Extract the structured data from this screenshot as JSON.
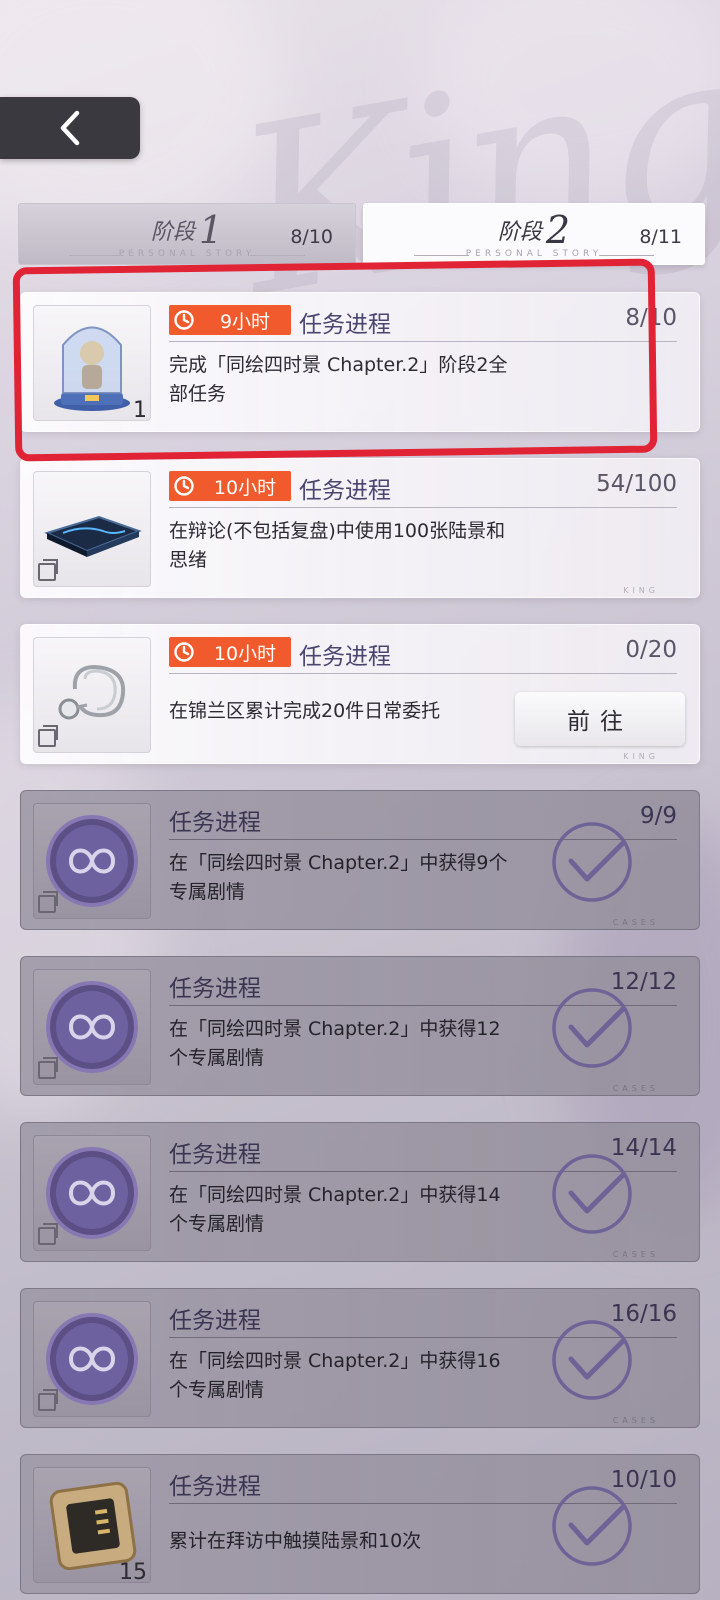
{
  "tabs": [
    {
      "stage_label": "阶段",
      "stage_number": "1",
      "subtitle": "PERSONAL STORY",
      "count": "8/10",
      "selected": false
    },
    {
      "stage_label": "阶段",
      "stage_number": "2",
      "subtitle": "PERSONAL STORY",
      "count": "8/11",
      "selected": true
    }
  ],
  "background_text": "King",
  "tasks": [
    {
      "timer": "9小时",
      "label": "任务进程",
      "progress": "8/10",
      "desc": "完成「同绘四时景 Chapter.2」阶段2全部任务",
      "qty": "1",
      "icon": "figure-capsule-icon",
      "state": "active"
    },
    {
      "timer": "10小时",
      "label": "任务进程",
      "progress": "54/100",
      "desc": "在辩论(不包括复盘)中使用100张陆景和思绪",
      "icon": "tablet-device-icon",
      "state": "active"
    },
    {
      "timer": "10小时",
      "label": "任务进程",
      "progress": "0/20",
      "desc": "在锦兰区累计完成20件日常委托",
      "icon": "stethoscope-icon",
      "action": "前往",
      "state": "active"
    },
    {
      "label": "任务进程",
      "progress": "9/9",
      "desc": "在「同绘四时景 Chapter.2」中获得9个专属剧情",
      "icon": "infinity-emblem-icon",
      "state": "done"
    },
    {
      "label": "任务进程",
      "progress": "12/12",
      "desc": "在「同绘四时景 Chapter.2」中获得12个专属剧情",
      "icon": "infinity-emblem-icon",
      "state": "done"
    },
    {
      "label": "任务进程",
      "progress": "14/14",
      "desc": "在「同绘四时景 Chapter.2」中获得14个专属剧情",
      "icon": "infinity-emblem-icon",
      "state": "done"
    },
    {
      "label": "任务进程",
      "progress": "16/16",
      "desc": "在「同绘四时景 Chapter.2」中获得16个专属剧情",
      "icon": "infinity-emblem-icon",
      "state": "done"
    },
    {
      "label": "任务进程",
      "progress": "10/10",
      "desc": "累计在拜访中触摸陆景和10次",
      "qty": "15",
      "icon": "chip-card-icon",
      "state": "done"
    }
  ],
  "colors": {
    "timer": "#f05a2c",
    "highlight": "#e02436",
    "label": "#4b4670"
  }
}
